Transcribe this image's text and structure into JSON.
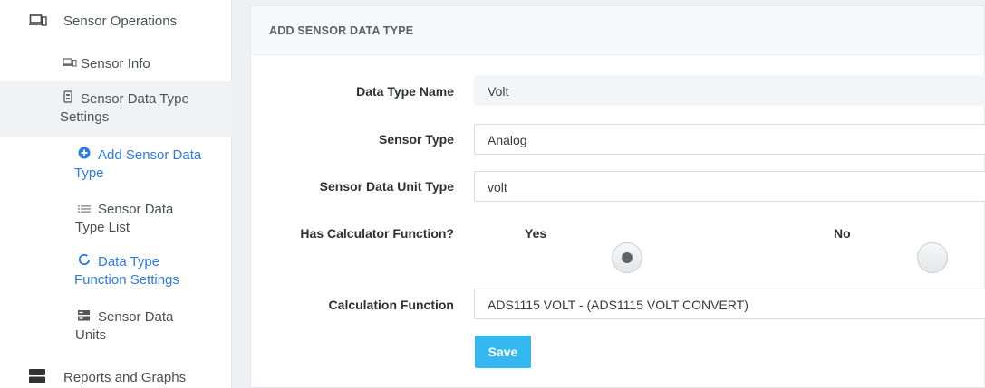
{
  "sidebar": {
    "sensor_operations": "Sensor Operations",
    "sensor_info": "Sensor Info",
    "sensor_data_type_settings_line1": "Sensor Data Type",
    "sensor_data_type_settings_line2": "Settings",
    "add_sensor_data_type_line1": "Add Sensor Data",
    "add_sensor_data_type_line2": "Type",
    "sensor_data_type_list_line1": "Sensor Data",
    "sensor_data_type_list_line2": "Type List",
    "data_type_function_settings_line1": "Data Type",
    "data_type_function_settings_line2": "Function Settings",
    "sensor_data_units_line1": "Sensor Data",
    "sensor_data_units_line2": "Units",
    "reports_and_graphs": "Reports and Graphs"
  },
  "panel": {
    "title": "ADD SENSOR DATA TYPE",
    "data_type_name_label": "Data Type Name",
    "data_type_name_value": "Volt",
    "sensor_type_label": "Sensor Type",
    "sensor_type_value": "Analog",
    "unit_type_label": "Sensor Data Unit Type",
    "unit_type_value": "volt",
    "has_calc_label": "Has Calculator Function?",
    "yes_label": "Yes",
    "no_label": "No",
    "has_calc_selected": "Yes",
    "calc_function_label": "Calculation Function",
    "calc_function_value": "ADS1115 VOLT - (ADS1115 VOLT CONVERT)",
    "save_label": "Save"
  },
  "colors": {
    "accent_blue": "#2f7be0",
    "save_button": "#35b8f0"
  }
}
